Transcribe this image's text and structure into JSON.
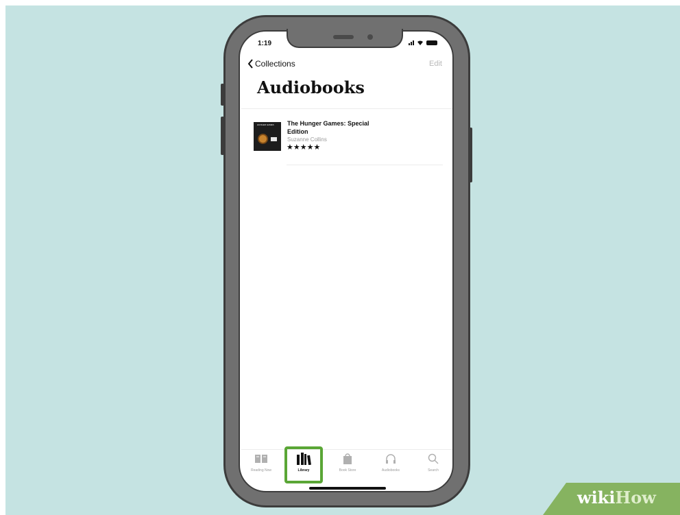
{
  "status_bar": {
    "time": "1:19"
  },
  "nav": {
    "back_label": "Collections",
    "edit_label": "Edit"
  },
  "page": {
    "title": "Audiobooks"
  },
  "book": {
    "title": "The Hunger Games: Special Edition",
    "author": "Suzanne Collins",
    "rating_stars": "★★★★★",
    "rating": 5,
    "cover_text": "HUNGER GAMES"
  },
  "tab_bar": {
    "items": [
      {
        "label": "Reading Now",
        "icon": "open-book-icon"
      },
      {
        "label": "Library",
        "icon": "library-books-icon",
        "active": true
      },
      {
        "label": "Book Store",
        "icon": "shopping-bag-icon"
      },
      {
        "label": "Audiobooks",
        "icon": "headphones-icon"
      },
      {
        "label": "Search",
        "icon": "search-icon"
      }
    ]
  },
  "watermark": {
    "wiki": "wiki",
    "how": "How"
  },
  "colors": {
    "highlight": "#5aa636",
    "background": "#c5e3e2",
    "phone_body": "#707070"
  }
}
